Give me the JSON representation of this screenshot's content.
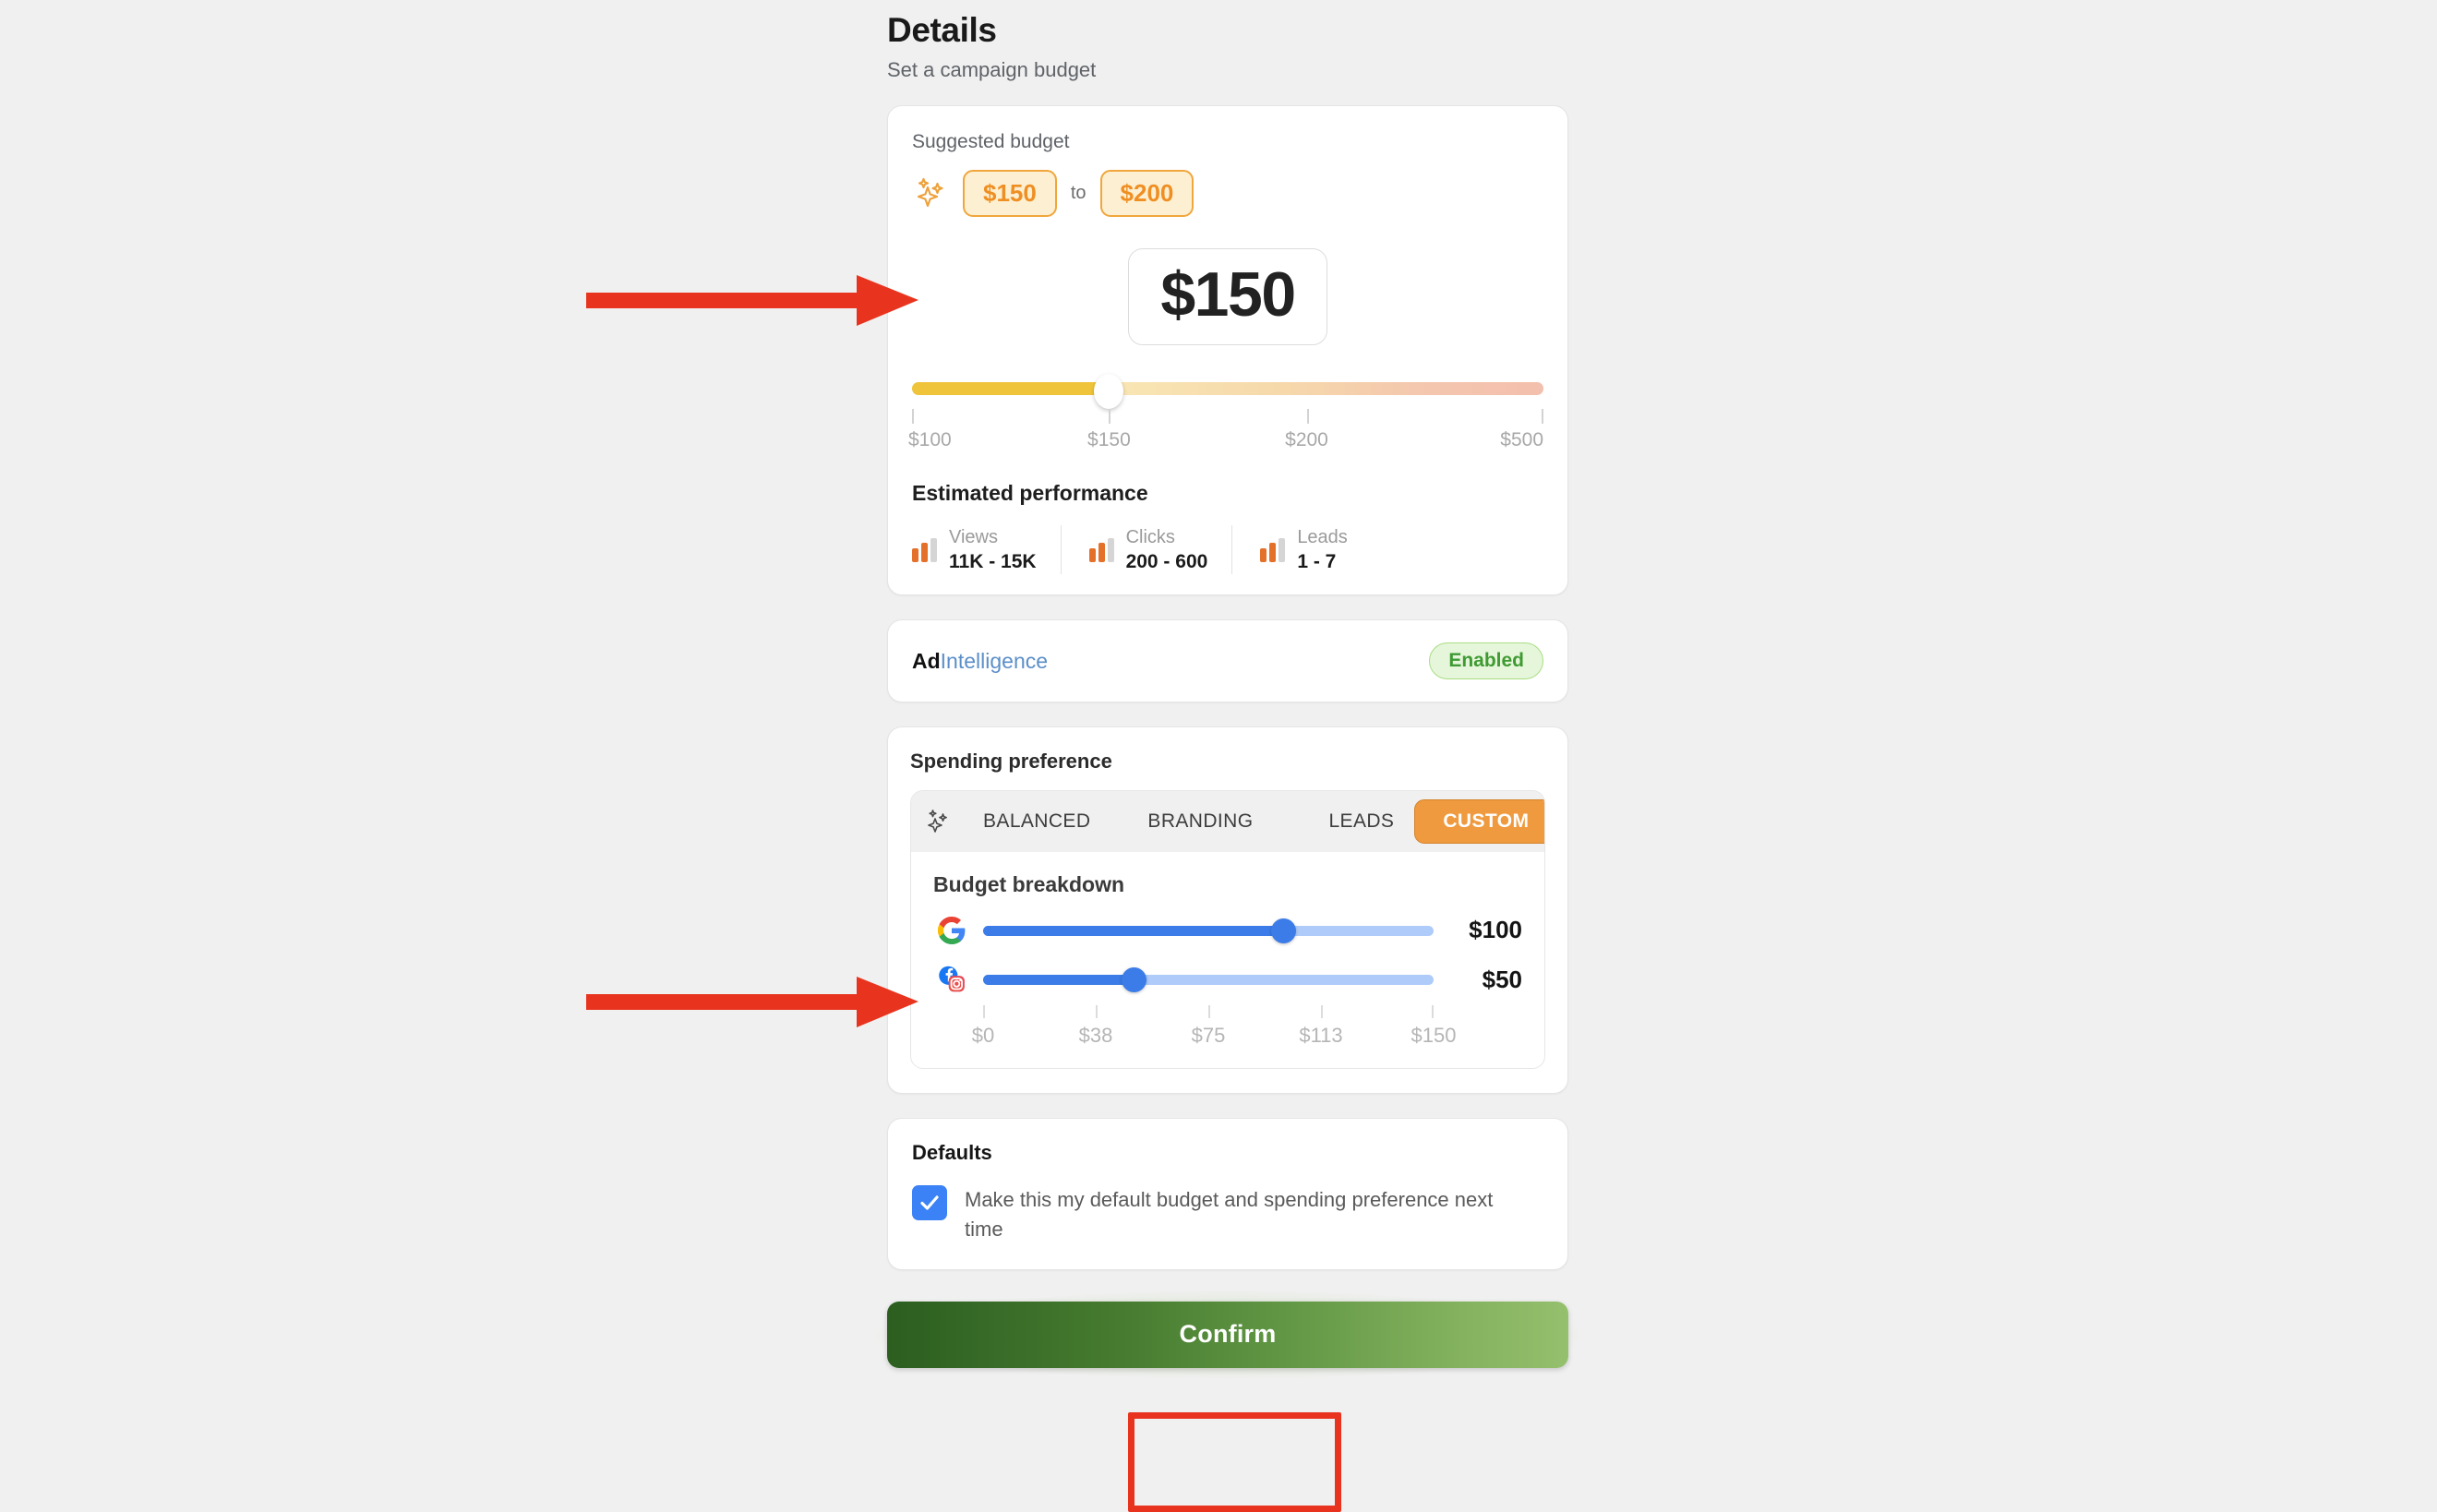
{
  "header": {
    "title": "Details",
    "subtitle": "Set a campaign budget"
  },
  "budget_card": {
    "suggested_label": "Suggested budget",
    "sparkle_icon": "sparkles-icon",
    "suggested_min": "$150",
    "suggested_sep": "to",
    "suggested_max": "$200",
    "amount": "$150",
    "slider": {
      "value": 150,
      "min": 100,
      "max": 500,
      "fill_percent": 31.2,
      "ticks": [
        "$100",
        "$150",
        "$200",
        "$500"
      ],
      "tick_positions": [
        0,
        31.2,
        62.5,
        100
      ]
    },
    "estimated": {
      "title": "Estimated performance",
      "metrics": [
        {
          "icon": "bar-chart-icon",
          "label": "Views",
          "value": "11K - 15K"
        },
        {
          "icon": "bar-chart-icon",
          "label": "Clicks",
          "value": "200 - 600"
        },
        {
          "icon": "bar-chart-icon",
          "label": "Leads",
          "value": "1 - 7"
        }
      ]
    }
  },
  "adintelligence": {
    "name_bold": "Ad",
    "name_light": "Intelligence",
    "badge": "Enabled",
    "badge_color": "#3f9a33"
  },
  "spending": {
    "title": "Spending preference",
    "sparkle_icon": "sparkles-icon",
    "tabs": [
      {
        "label": "BALANCED",
        "active": false
      },
      {
        "label": "BRANDING",
        "active": false
      },
      {
        "label": "LEADS",
        "active": false
      },
      {
        "label": "CUSTOM",
        "active": true
      }
    ],
    "active_tab": "CUSTOM",
    "active_tab_color": "#ef9a3f",
    "breakdown": {
      "title": "Budget breakdown",
      "rows": [
        {
          "icon": "google-icon",
          "value": "$100",
          "amount": 100,
          "fill_percent": 66.7
        },
        {
          "icon": "facebook-instagram-icon",
          "value": "$50",
          "amount": 50,
          "fill_percent": 33.3
        }
      ],
      "ticks": [
        "$0",
        "$38",
        "$75",
        "$113",
        "$150"
      ],
      "tick_positions": [
        0,
        25,
        50,
        75,
        100
      ],
      "scale_min": 0,
      "scale_max": 150,
      "track_color": "#3b7ce8"
    }
  },
  "defaults": {
    "title": "Defaults",
    "checkbox_checked": true,
    "checkbox_label": "Make this my default budget and spending preference next time"
  },
  "confirm": {
    "label": "Confirm"
  },
  "annotations": {
    "arrow_1": "red-arrow-to-budget-amount",
    "arrow_2": "red-arrow-to-budget-breakdown",
    "highlight_box": "red-highlight-on-confirm",
    "color": "#e8341f"
  }
}
